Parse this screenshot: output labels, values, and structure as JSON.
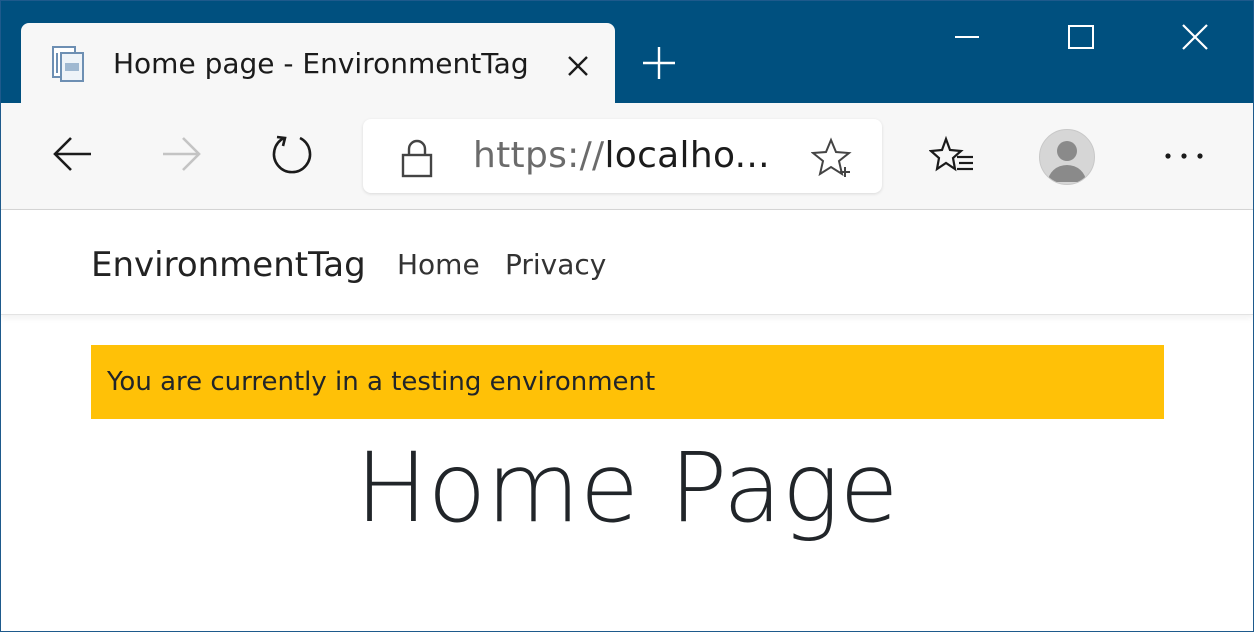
{
  "browser": {
    "tab": {
      "title": "Home page - EnvironmentTag",
      "favicon": "page-icon"
    },
    "address": {
      "scheme": "https://",
      "rest": "localho...",
      "lock_icon": "lock-icon"
    },
    "icons": {
      "back": "back-arrow-icon",
      "forward": "forward-arrow-icon",
      "refresh": "refresh-icon",
      "add_favorite": "star-plus-icon",
      "favorites": "favorites-list-icon",
      "profile": "profile-avatar-icon",
      "more": "more-dots-icon"
    },
    "colors": {
      "titlebar": "#00507f",
      "toolbar": "#f7f7f7"
    }
  },
  "site": {
    "brand": "EnvironmentTag",
    "nav": {
      "home": "Home",
      "privacy": "Privacy"
    },
    "alert": {
      "text": "You are currently in a testing environment",
      "color": "#ffc107"
    },
    "heading": "Home Page"
  }
}
